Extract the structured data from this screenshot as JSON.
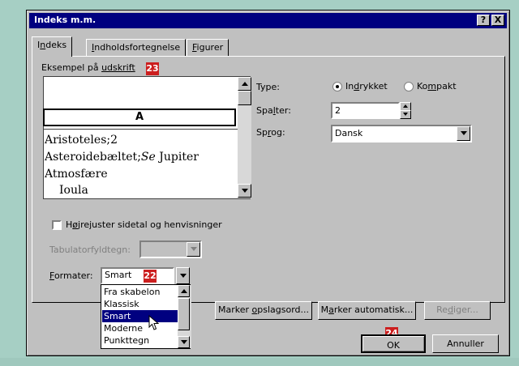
{
  "dialog": {
    "title": "Indeks m.m.",
    "help_btn": "?",
    "close_btn": "X"
  },
  "tabs": [
    {
      "pre": "I",
      "u": "n",
      "post": "deks"
    },
    {
      "pre": "",
      "u": "I",
      "post": "ndholdsfortegnelse"
    },
    {
      "pre": "",
      "u": "F",
      "post": "igurer"
    }
  ],
  "preview": {
    "label_pre": "Eksempel på ",
    "label_u": "udskrift",
    "letter": "A",
    "entries": [
      "Aristoteles;2",
      "Asteroidebæltet;",
      "Se",
      " Jupiter",
      "Atmosfære",
      "Ioula"
    ]
  },
  "type": {
    "label": "Type:",
    "options": [
      {
        "pre": "In",
        "u": "d",
        "post": "rykket",
        "selected": true
      },
      {
        "pre": "Ko",
        "u": "m",
        "post": "pakt",
        "selected": false
      }
    ]
  },
  "spalter": {
    "pre": "Spa",
    "u": "l",
    "post": "ter:",
    "value": "2"
  },
  "sprog": {
    "pre": "Sp",
    "u": "r",
    "post": "og:",
    "value": "Dansk"
  },
  "right_align": {
    "pre": "H",
    "u": "ø",
    "post": "jrejuster sidetal og henvisninger",
    "checked": false
  },
  "tab_leader": {
    "label": "Tabulatorfyldtegn:",
    "value": ""
  },
  "formater": {
    "pre": "",
    "u": "F",
    "post": "ormater:",
    "value": "Smart",
    "options": [
      "Fra skabelon",
      "Klassisk",
      "Smart",
      "Moderne",
      "Punkttegn"
    ],
    "selected_index": 2
  },
  "buttons": {
    "marker_opslagsord": {
      "pre": "Marker ",
      "u": "o",
      "post": "pslagsord..."
    },
    "marker_automatisk": {
      "pre": "M",
      "u": "a",
      "post": "rker automatisk..."
    },
    "rediger": {
      "pre": "Re",
      "u": "d",
      "post": "iger..."
    },
    "ok": "OK",
    "annuller": "Annuller"
  },
  "markers": [
    "23",
    "22",
    "24"
  ],
  "colors": {
    "titlebar": "#000080",
    "marker": "#cc1f1f",
    "background": "#a6cfc4"
  }
}
